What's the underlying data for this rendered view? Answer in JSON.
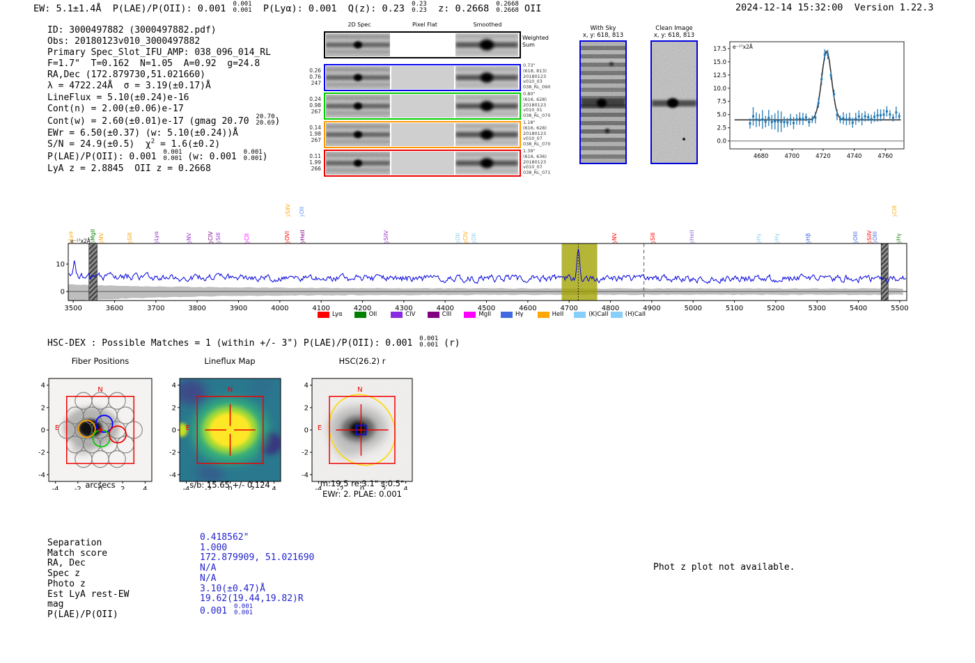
{
  "title_bar": {
    "left_parts": [
      {
        "t": "EW: 5.1±1.4Å  P(LAE)/P(OII): 0.001 "
      },
      {
        "frac": [
          "0.001",
          "0.001"
        ]
      },
      {
        "t": "  P(Lyα): 0.001  Q(z): 0.23 "
      },
      {
        "frac": [
          "0.23",
          "0.23"
        ]
      },
      {
        "t": "  z: 0.2668 "
      },
      {
        "frac": [
          "0.2668",
          "0.2668"
        ]
      },
      {
        "t": " OII"
      }
    ],
    "timestamp": "2024-12-14 15:32:00",
    "version": "Version 1.22.3"
  },
  "info_block": {
    "lines": [
      [
        {
          "t": "ID: 3000497882 (3000497882.pdf)"
        }
      ],
      [
        {
          "t": "Obs: 20180123v010_3000497882"
        }
      ],
      [
        {
          "t": "Primary Spec_Slot_IFU_AMP: 038_096_014_RL"
        }
      ],
      [
        {
          "t": "F=1.7\"  T=0.162  N=1.05  A=0.92  g=24.8"
        }
      ],
      [
        {
          "t": "RA,Dec (172.879730,51.021660)"
        }
      ],
      [
        {
          "t": "λ = 4722.24Å  σ = 3.19(±0.17)Å"
        }
      ],
      [
        {
          "t": "LineFlux = 5.10(±0.24)e-16"
        }
      ],
      [
        {
          "t": "Cont(n) = 2.00(±0.06)e-17"
        }
      ],
      [
        {
          "t": "Cont(w) = 2.60(±0.01)e-17 (gmag 20.70 "
        },
        {
          "frac": [
            "20.70",
            "20.69"
          ]
        },
        {
          "t": ")"
        }
      ],
      [
        {
          "t": "EWr = 6.50(±0.37) (w: 5.10(±0.24))Å"
        }
      ],
      [
        {
          "t": "S/N = 24.9(±0.5)  χ"
        },
        {
          "sup": "2"
        },
        {
          "t": " = 1.6(±0.2)"
        }
      ],
      [
        {
          "t": "P(LAE)/P(OII): 0.001 "
        },
        {
          "frac": [
            "0.001",
            "0.001"
          ]
        },
        {
          "t": " (w: 0.001 "
        },
        {
          "frac": [
            "0.001",
            "0.001"
          ]
        },
        {
          "t": ")"
        }
      ],
      [
        {
          "t": "LyA z = 2.8845  OII z = 0.2668"
        }
      ]
    ]
  },
  "cutouts": {
    "col_headers": [
      "2D Spec",
      "Pixel Flat",
      "Smoothed"
    ],
    "weighted_row": {
      "border": "#000000",
      "right_label": "Weighted Sum"
    },
    "rows": [
      {
        "border": "#0000ee",
        "left": [
          "0.26",
          "0.76",
          "247"
        ],
        "right": [
          "0.73\"",
          "(618, 813)",
          "20180123",
          "v010_03",
          "038_RL_090"
        ]
      },
      {
        "border": "#00cc00",
        "left": [
          "0.24",
          "0.98",
          "267"
        ],
        "right": [
          "0.80\"",
          "(616, 628)",
          "20180123",
          "v010_01",
          "038_RL_070"
        ]
      },
      {
        "border": "#ff9800",
        "left": [
          "0.14",
          "1.98",
          "267"
        ],
        "right": [
          "1.18\"",
          "(616, 628)",
          "20180123",
          "v010_07",
          "038_RL_070"
        ]
      },
      {
        "border": "#ee0000",
        "left": [
          "0.11",
          "1.99",
          "266"
        ],
        "right": [
          "1.39\"",
          "(616, 636)",
          "20180123",
          "v010_07",
          "038_RL_071"
        ]
      }
    ]
  },
  "sky_panels": [
    {
      "title": "With Sky",
      "subtitle": "x, y: 618, 813"
    },
    {
      "title": "Clean Image",
      "subtitle": "x, y: 618, 813"
    }
  ],
  "hsc_dex_parts": [
    {
      "t": "HSC-DEX : Possible Matches = 1 (within +/- 3\")  P(LAE)/P(OII): 0.001 "
    },
    {
      "frac": [
        "0.001",
        "0.001"
      ]
    },
    {
      "t": " (r)"
    }
  ],
  "spectrum_legend": [
    {
      "label": "Lyα",
      "color": "#ff0000"
    },
    {
      "label": "OII",
      "color": "#008000"
    },
    {
      "label": "CIV",
      "color": "#8a2be2"
    },
    {
      "label": "CIII",
      "color": "#800080"
    },
    {
      "label": "MgII",
      "color": "#ff00ff"
    },
    {
      "label": "Hγ",
      "color": "#4169e1"
    },
    {
      "label": "HeII",
      "color": "#ffa500"
    },
    {
      "label": "(K)CaII",
      "color": "#87cefa"
    },
    {
      "label": "(H)CaII",
      "color": "#87cefa"
    }
  ],
  "match_table": {
    "labels": [
      "Separation",
      "Match score",
      "RA, Dec",
      "Spec z",
      "Photo z",
      "Est LyA rest-EW",
      "mag",
      "P(LAE)/P(OII)"
    ],
    "values": [
      [
        {
          "t": "0.418562\""
        }
      ],
      [
        {
          "t": "1.000"
        }
      ],
      [
        {
          "t": "172.879909, 51.021690"
        }
      ],
      [
        {
          "t": "N/A"
        }
      ],
      [
        {
          "t": "N/A"
        }
      ],
      [
        {
          "t": "3.10(±0.47)Å"
        }
      ],
      [
        {
          "t": "19.62(19.44,19.82)R"
        }
      ],
      [
        {
          "t": "0.001 "
        },
        {
          "frac": [
            "0.001",
            "0.001"
          ]
        }
      ]
    ]
  },
  "notice": "Phot z plot not available.",
  "chart_data": [
    {
      "id": "line_fit_plot",
      "type": "scatter",
      "unit_label": "e⁻¹⁷x2Å",
      "xticks": [
        4680,
        4700,
        4720,
        4740,
        4760
      ],
      "yticks": [
        "0.0",
        "2.5",
        "5.0",
        "7.5",
        "10.0",
        "12.5",
        "15.0",
        "17.5"
      ],
      "xlim": [
        4660,
        4772
      ],
      "ylim": [
        -1.5,
        18.8
      ],
      "fit_gaussian": {
        "mu": 4722.24,
        "sigma": 3.19,
        "baseline": 4.0,
        "peak": 17.0
      },
      "points": {
        "x_start": 4673,
        "x_end": 4769,
        "step": 2,
        "noise_amp": 0.7,
        "seed": 7
      },
      "point_color": "#1f77b4",
      "fit_color": "#333333"
    },
    {
      "id": "full_spectrum",
      "type": "line",
      "unit_label": "e⁻¹⁷x2Å",
      "xlim": [
        3488,
        5517
      ],
      "xticks": [
        3500,
        3600,
        3700,
        3800,
        3900,
        4000,
        4100,
        4200,
        4300,
        4400,
        4500,
        4600,
        4700,
        4800,
        4900,
        5000,
        5100,
        5200,
        5300,
        5400,
        5500
      ],
      "yticks": [
        0,
        10
      ],
      "ylim": [
        -3.3,
        17.5
      ],
      "continuum": 4.7,
      "noise_amp": 1.1,
      "seed": 42,
      "emission_peak": {
        "mu": 4722.24,
        "sigma": 3.3,
        "amp": 12.3
      },
      "left_spike": {
        "mu": 3503,
        "sigma": 3.5,
        "amp": 6.0
      },
      "highlight_band": [
        4682,
        4768
      ],
      "masked_bands": [
        [
          3538,
          3558
        ],
        [
          5455,
          5472
        ]
      ],
      "dotted_marker": 4722.24,
      "dashed_marker": 4881,
      "line_color": "#0000dd",
      "band_color": "#a0a000",
      "line_labels": [
        {
          "n": "Lyα",
          "wl": 3497,
          "c": "#ffa500",
          "h": 0
        },
        {
          "n": "MgII",
          "wl": 3551,
          "c": "#008000",
          "h": 0
        },
        {
          "n": "NV",
          "wl": 3571,
          "c": "#ffa500",
          "h": 0
        },
        {
          "n": "SiII",
          "wl": 3639,
          "c": "#ffa500",
          "h": 0
        },
        {
          "n": "Lyα",
          "wl": 3703,
          "c": "#9932cc",
          "h": 0
        },
        {
          "n": "NV",
          "wl": 3783,
          "c": "#9932cc",
          "h": 0
        },
        {
          "n": "CIV",
          "wl": 3835,
          "c": "#800080",
          "h": 0
        },
        {
          "n": "SiII",
          "wl": 3853,
          "c": "#9932cc",
          "h": 0
        },
        {
          "n": "CII",
          "wl": 3922,
          "c": "#ff00ff",
          "h": 0
        },
        {
          "n": "OVI",
          "wl": 4020,
          "c": "#ff0000",
          "h": 0
        },
        {
          "n": "SiIV",
          "wl": 4022,
          "c": "#ffa500",
          "h": 1
        },
        {
          "n": "OII",
          "wl": 4056,
          "c": "#6495ed",
          "h": 1
        },
        {
          "n": "HeII",
          "wl": 4058,
          "c": "#800080",
          "h": 0
        },
        {
          "n": "SiIV",
          "wl": 4259,
          "c": "#9932cc",
          "h": 0
        },
        {
          "n": "OII",
          "wl": 4433,
          "c": "#87ceeb",
          "h": 0
        },
        {
          "n": "CIV",
          "wl": 4452,
          "c": "#ffa500",
          "h": 0
        },
        {
          "n": "OII",
          "wl": 4473,
          "c": "#87ceeb",
          "h": 0
        },
        {
          "n": "NV",
          "wl": 4813,
          "c": "#ff0000",
          "h": 0
        },
        {
          "n": "SiII",
          "wl": 4906,
          "c": "#ff0000",
          "h": 0
        },
        {
          "n": "HeII",
          "wl": 4999,
          "c": "#9370db",
          "h": 0
        },
        {
          "n": "Hγ",
          "wl": 5162,
          "c": "#87ceeb",
          "h": 0
        },
        {
          "n": "Hγ",
          "wl": 5205,
          "c": "#87ceeb",
          "h": 0
        },
        {
          "n": "Hβ",
          "wl": 5281,
          "c": "#4169e1",
          "h": 0
        },
        {
          "n": "OIII",
          "wl": 5395,
          "c": "#4169e1",
          "h": 0
        },
        {
          "n": "SiIV",
          "wl": 5429,
          "c": "#ff0000",
          "h": 0
        },
        {
          "n": "OIII",
          "wl": 5443,
          "c": "#4169e1",
          "h": 0
        },
        {
          "n": "CIII",
          "wl": 5490,
          "c": "#ffa500",
          "h": 1
        },
        {
          "n": "Hγ",
          "wl": 5500,
          "c": "#228b22",
          "h": 0
        }
      ]
    },
    {
      "id": "fiber_positions",
      "type": "scatter",
      "title": "Fiber Positions",
      "xlabel": "arcsecs",
      "ticks": [
        -4,
        -2,
        0,
        2,
        4
      ],
      "square_extent": [
        -3,
        3
      ],
      "fiber_radius": 0.75,
      "compass": {
        "north": "N",
        "east": "E"
      },
      "highlight_fibers": [
        {
          "color": "#ffa500",
          "x": -1.2,
          "y": 0.1
        },
        {
          "color": "#0000ff",
          "x": 0.35,
          "y": 0.55
        },
        {
          "color": "#00cc00",
          "x": 0.1,
          "y": -0.75
        },
        {
          "color": "#ee0000",
          "x": 1.55,
          "y": -0.4
        }
      ]
    },
    {
      "id": "lineflux_map",
      "type": "heatmap",
      "title": "Lineflux Map",
      "xlabel": "s/b: 15.65 +/- 0.124",
      "ticks": [
        -4,
        -2,
        0,
        2,
        4
      ],
      "colormap": "viridis",
      "compass": {
        "north": "N",
        "east": "E"
      }
    },
    {
      "id": "hsc_cutout",
      "type": "image",
      "title": "HSC(26.2) r",
      "xlabel": "m:19.5 re:3.1\" s:0.5\"",
      "xlabel2": "EWr: 2. PLAE: 0.001",
      "ticks": [
        -4,
        -2,
        0,
        2,
        4
      ],
      "compass": {
        "north": "N",
        "east": "E"
      }
    }
  ]
}
